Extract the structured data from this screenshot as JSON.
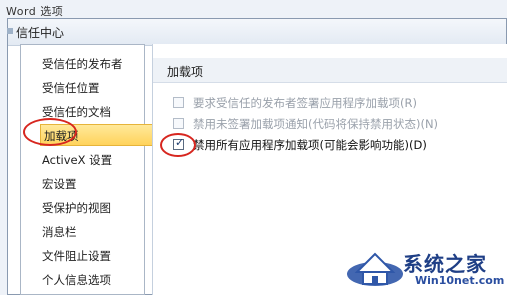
{
  "background_window": {
    "title": "Word 选项"
  },
  "dialog": {
    "title": "信任中心"
  },
  "sidebar": {
    "items": [
      {
        "label": "受信任的发布者"
      },
      {
        "label": "受信任位置"
      },
      {
        "label": "受信任的文档"
      },
      {
        "label": "加载项",
        "selected": true
      },
      {
        "label": "ActiveX 设置"
      },
      {
        "label": "宏设置"
      },
      {
        "label": "受保护的视图"
      },
      {
        "label": "消息栏"
      },
      {
        "label": "文件阻止设置"
      },
      {
        "label": "个人信息选项"
      }
    ]
  },
  "main": {
    "section_title": "加载项",
    "options": [
      {
        "label": "要求受信任的发布者签署应用程序加载项(R)",
        "checked": false,
        "enabled": false
      },
      {
        "label": "禁用未签署加载项通知(代码将保持禁用状态)(N)",
        "checked": false,
        "enabled": false
      },
      {
        "label": "禁用所有应用程序加载项(可能会影响功能)(D)",
        "checked": true,
        "enabled": true
      }
    ]
  },
  "watermark": {
    "name": "系统之家",
    "site": "Win10net.com",
    "house_icon": "house-logo-icon"
  },
  "colors": {
    "highlight": "#ffd35c",
    "annotation": "#d7261f",
    "logo": "#1f3f86"
  }
}
